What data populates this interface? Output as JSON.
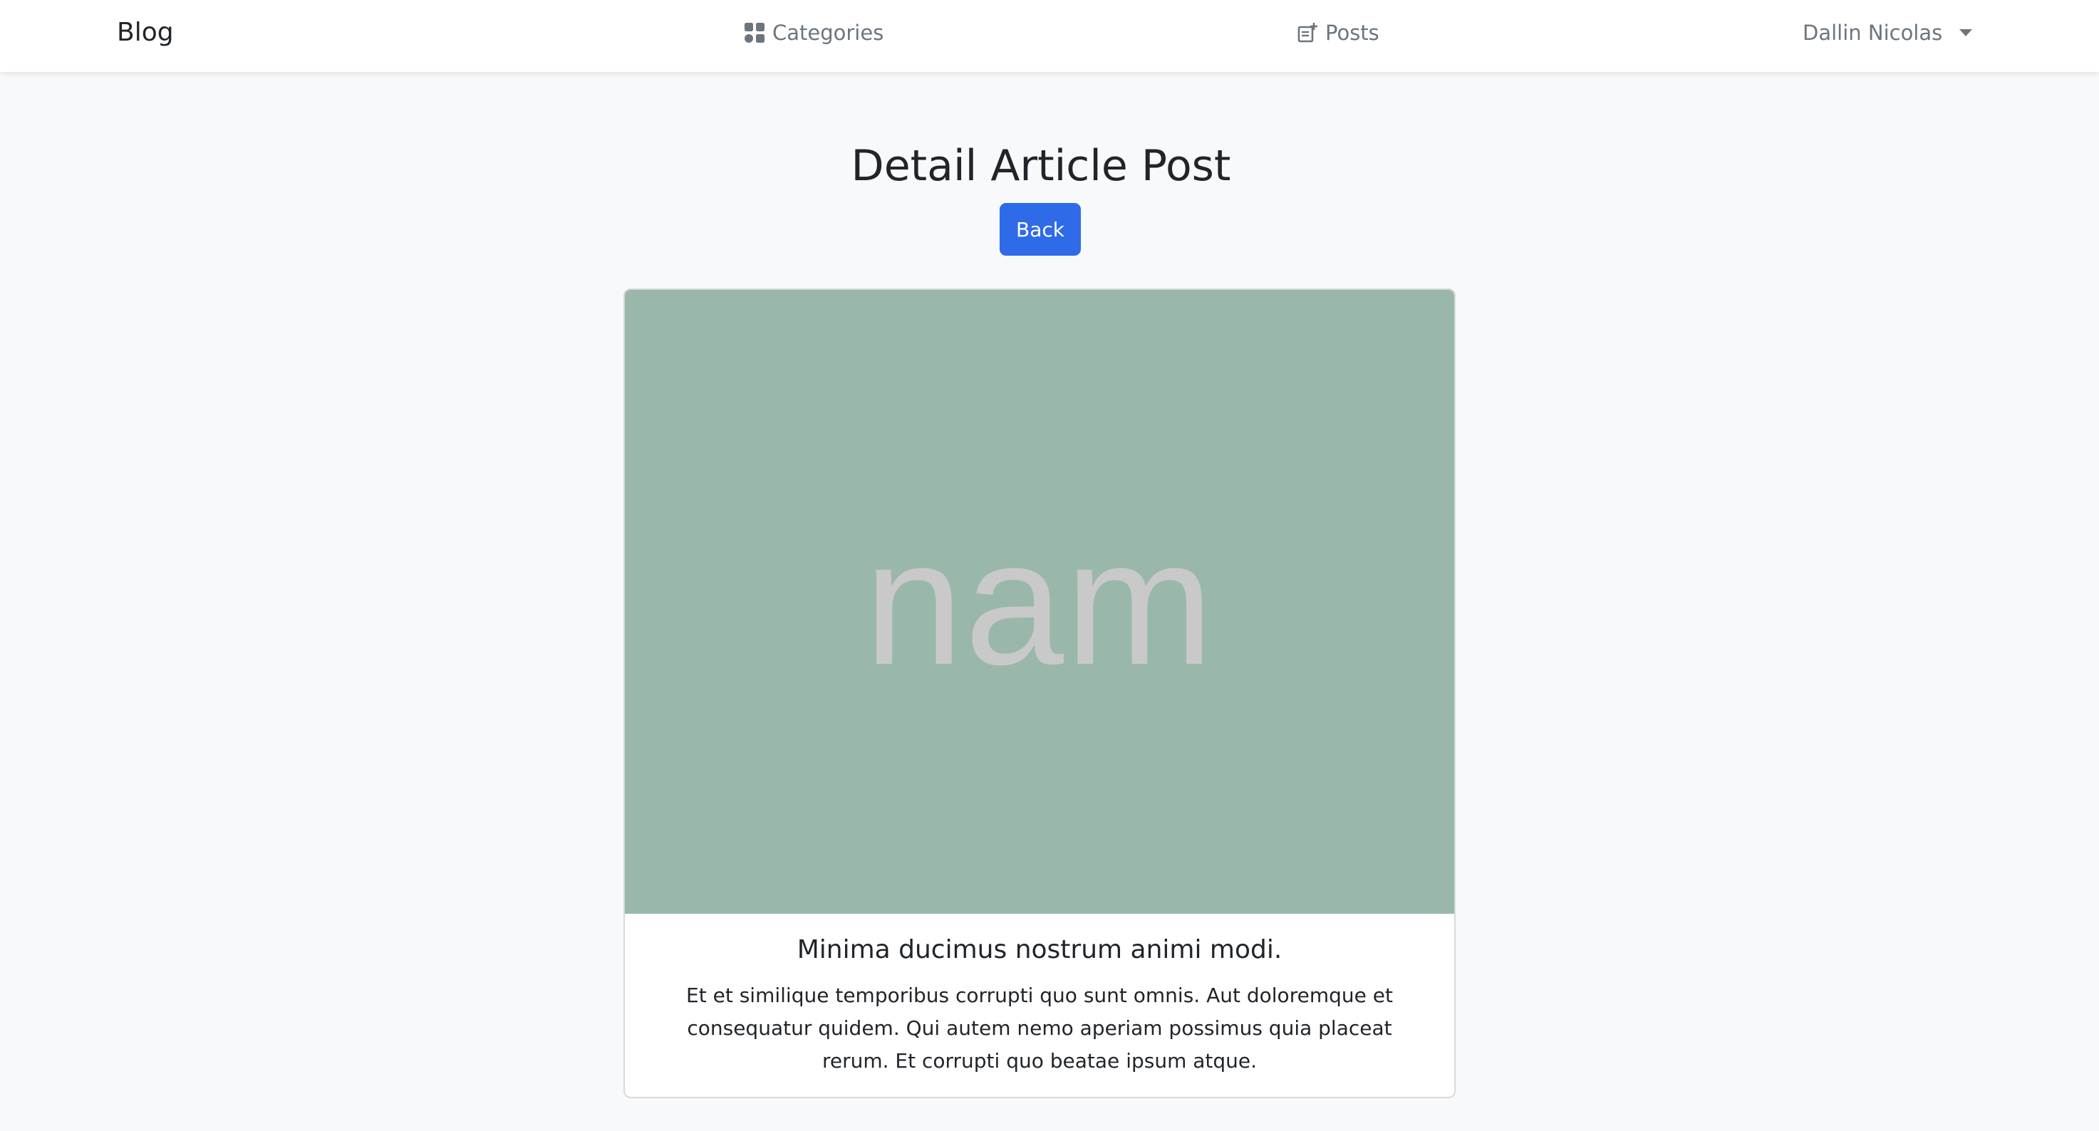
{
  "navbar": {
    "brand": "Blog",
    "categories_label": "Categories",
    "categories_icon": "grid-icon",
    "posts_label": "Posts",
    "posts_icon": "post-add-icon",
    "user_name": "Dallin Nicolas"
  },
  "page": {
    "title": "Detail Article Post",
    "back_label": "Back"
  },
  "post": {
    "image_text": "nam",
    "image_bg_color": "#99b8a9",
    "title": "Minima ducimus nostrum animi modi.",
    "body": "Et et similique temporibus corrupti quo sunt omnis. Aut doloremque et consequatur quidem. Qui autem nemo aperiam possimus quia placeat rerum. Et corrupti quo beatae ipsum atque."
  },
  "colors": {
    "accent": "#2f6be8",
    "background": "#f8f9fa",
    "nav_text": "#6c757d"
  }
}
